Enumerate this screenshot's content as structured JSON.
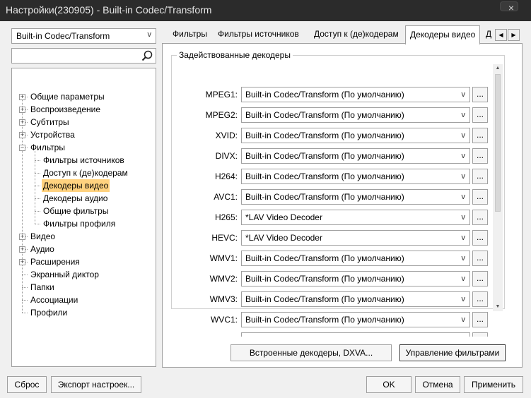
{
  "window": {
    "title": "Настройки(230905) - Built-in Codec/Transform"
  },
  "left": {
    "filter_combo_value": "Built-in Codec/Transform",
    "search_value": "",
    "tree": [
      {
        "label": "Общие параметры",
        "expandable": true,
        "expander": "+"
      },
      {
        "label": "Воспроизведение",
        "expandable": true,
        "expander": "+"
      },
      {
        "label": "Субтитры",
        "expandable": true,
        "expander": "+"
      },
      {
        "label": "Устройства",
        "expandable": true,
        "expander": "+"
      },
      {
        "label": "Фильтры",
        "expandable": true,
        "expander": "−"
      },
      {
        "label": "Фильтры источников",
        "child": true
      },
      {
        "label": "Доступ к (де)кодерам",
        "child": true
      },
      {
        "label": "Декодеры видео",
        "child": true,
        "selected": true
      },
      {
        "label": "Декодеры аудио",
        "child": true
      },
      {
        "label": "Общие фильтры",
        "child": true
      },
      {
        "label": "Фильтры профиля",
        "child": true
      },
      {
        "label": "Видео",
        "expandable": true,
        "expander": "+"
      },
      {
        "label": "Аудио",
        "expandable": true,
        "expander": "+"
      },
      {
        "label": "Расширения",
        "expandable": true,
        "expander": "+"
      },
      {
        "label": "Экранный диктор"
      },
      {
        "label": "Папки"
      },
      {
        "label": "Ассоциации"
      },
      {
        "label": "Профили"
      }
    ]
  },
  "tabs": [
    {
      "label": "Фильтры"
    },
    {
      "label": "Фильтры источников"
    },
    {
      "label": "Доступ к (де)кодерам"
    },
    {
      "label": "Декодеры видео",
      "active": true
    },
    {
      "label": "Д"
    }
  ],
  "tab_scroll": {
    "left": "◀",
    "right": "▶"
  },
  "group": {
    "title": "Задействованные декодеры",
    "ellipsis": "...",
    "decoders": [
      {
        "label": "MPEG1:",
        "value": "Built-in Codec/Transform (По умолчанию)"
      },
      {
        "label": "MPEG2:",
        "value": "Built-in Codec/Transform (По умолчанию)"
      },
      {
        "label": "XVID:",
        "value": "Built-in Codec/Transform (По умолчанию)"
      },
      {
        "label": "DIVX:",
        "value": "Built-in Codec/Transform (По умолчанию)"
      },
      {
        "label": "H264:",
        "value": "Built-in Codec/Transform (По умолчанию)"
      },
      {
        "label": "AVC1:",
        "value": "Built-in Codec/Transform (По умолчанию)"
      },
      {
        "label": "H265:",
        "value": "*LAV Video Decoder"
      },
      {
        "label": "HEVC:",
        "value": "*LAV Video Decoder"
      },
      {
        "label": "WMV1:",
        "value": "Built-in Codec/Transform (По умолчанию)"
      },
      {
        "label": "WMV2:",
        "value": "Built-in Codec/Transform (По умолчанию)"
      },
      {
        "label": "WMV3:",
        "value": "Built-in Codec/Transform (По умолчанию)"
      },
      {
        "label": "WVC1:",
        "value": "Built-in Codec/Transform (По умолчанию)"
      }
    ]
  },
  "panel_buttons": {
    "builtin_dxva": "Встроенные декодеры, DXVA...",
    "manage_filters": "Управление фильтрами"
  },
  "footer": {
    "reset": "Сброс",
    "export": "Экспорт настроек...",
    "ok": "OK",
    "cancel": "Отмена",
    "apply": "Применить"
  },
  "icons": {
    "dropdown": "v",
    "close": "×"
  },
  "colors": {
    "titlebar": "#2b2b2b",
    "selection": "#ffd27f"
  }
}
